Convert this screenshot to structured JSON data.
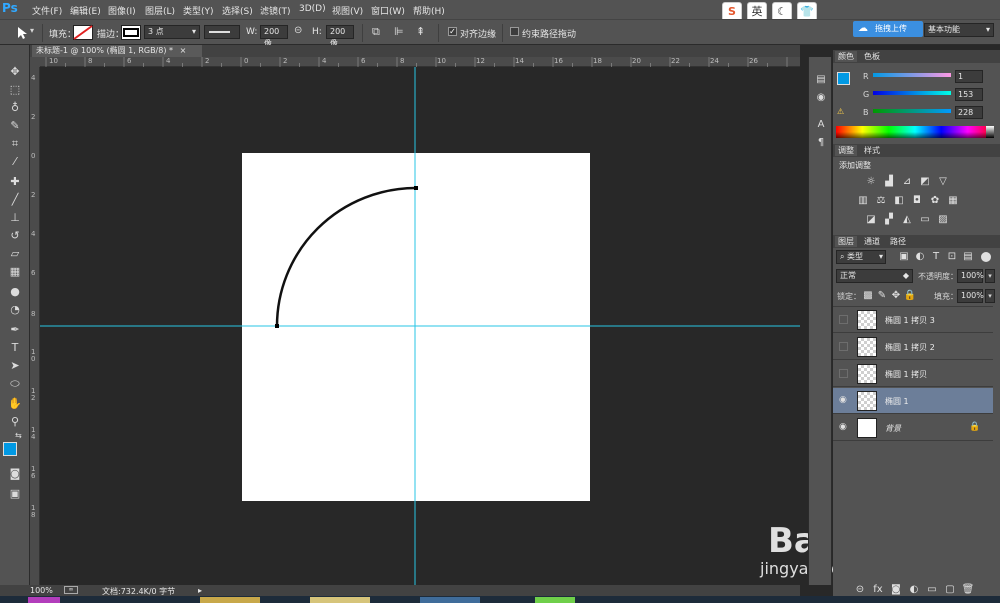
{
  "app": {
    "logo": "Ps"
  },
  "menu": [
    "文件(F)",
    "编辑(E)",
    "图像(I)",
    "图层(L)",
    "类型(Y)",
    "选择(S)",
    "滤镜(T)",
    "3D(D)",
    "视图(V)",
    "窗口(W)",
    "帮助(H)"
  ],
  "options": {
    "fill_label": "填充：",
    "stroke_label": "描边：",
    "stroke_size": "3 点",
    "w_label": "W:",
    "w_value": "200 像",
    "h_label": "H:",
    "h_value": "200 像",
    "align_edges": "对齐边缘",
    "constrain_path": "约束路径拖动",
    "upload_btn": "拖拽上传",
    "workspace": "基本功能"
  },
  "ime": {
    "logo": "S",
    "lang": "英",
    "moon": "☾",
    "shirt": "👕"
  },
  "document": {
    "tab_title": "未标题-1 @ 100% (椭圆 1, RGB/8) *",
    "close": "×"
  },
  "ruler_top": [
    "10",
    "8",
    "6",
    "4",
    "2",
    "0",
    "2",
    "4",
    "6",
    "8",
    "10",
    "12",
    "14",
    "16",
    "18",
    "20",
    "22",
    "24",
    "26"
  ],
  "ruler_left": [
    "4",
    "2",
    "0",
    "2",
    "4",
    "6",
    "8",
    "1 0",
    "1 2",
    "1 4",
    "1 6",
    "1 8"
  ],
  "status": {
    "zoom": "100%",
    "doc_info": "文档:732.4K/0 字节"
  },
  "color_panel": {
    "tabs": [
      "颜色",
      "色板"
    ],
    "r_label": "R",
    "g_label": "G",
    "b_label": "B",
    "r": "1",
    "g": "153",
    "b": "228",
    "fg_color": "#0199e4"
  },
  "adjust_panel": {
    "tabs": [
      "调整",
      "样式"
    ],
    "title": "添加调整"
  },
  "layers_panel": {
    "tabs": [
      "图层",
      "通道",
      "路径"
    ],
    "filter_kind": "类型",
    "blend_mode": "正常",
    "opacity_label": "不透明度：",
    "opacity": "100%",
    "lock_label": "锁定：",
    "fill_label": "填充：",
    "fill": "100%",
    "layers": [
      {
        "name": "椭圆 1 拷贝 3",
        "visible": false,
        "selected": false
      },
      {
        "name": "椭圆 1 拷贝 2",
        "visible": false,
        "selected": false
      },
      {
        "name": "椭圆 1 拷贝",
        "visible": false,
        "selected": false
      },
      {
        "name": "椭圆 1",
        "visible": true,
        "selected": true
      },
      {
        "name": "背景",
        "visible": true,
        "selected": false
      }
    ]
  },
  "watermark": {
    "brand": "Bai 经验",
    "url": "jingyan.baidu.com"
  }
}
